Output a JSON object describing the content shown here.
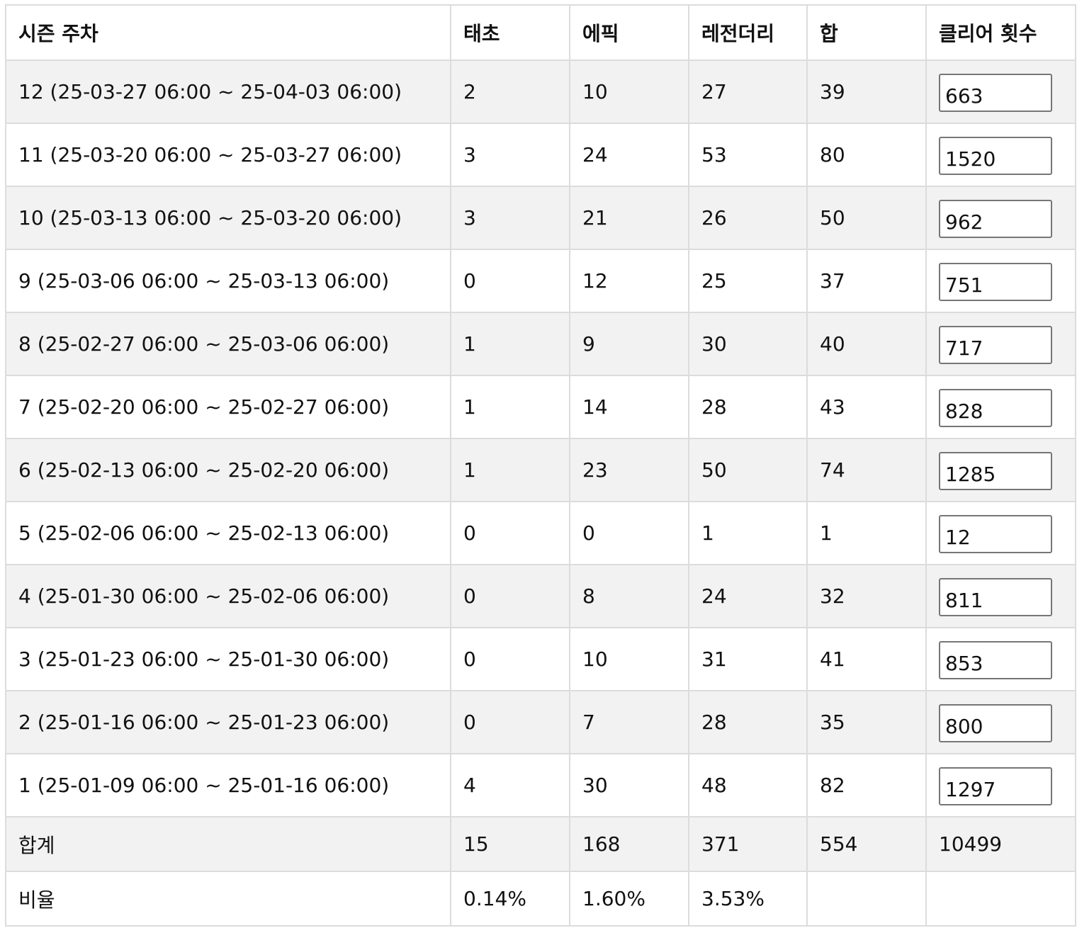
{
  "header": {
    "week": "시즌 주차",
    "taecho": "태초",
    "epic": "에픽",
    "legendary": "레전더리",
    "sum": "합",
    "clears": "클리어 횟수"
  },
  "rows": [
    {
      "week": "12 (25-03-27 06:00 ~ 25-04-03 06:00)",
      "taecho": "2",
      "epic": "10",
      "legendary": "27",
      "sum": "39",
      "clears": "663"
    },
    {
      "week": "11 (25-03-20 06:00 ~ 25-03-27 06:00)",
      "taecho": "3",
      "epic": "24",
      "legendary": "53",
      "sum": "80",
      "clears": "1520"
    },
    {
      "week": "10 (25-03-13 06:00 ~ 25-03-20 06:00)",
      "taecho": "3",
      "epic": "21",
      "legendary": "26",
      "sum": "50",
      "clears": "962"
    },
    {
      "week": "9 (25-03-06 06:00 ~ 25-03-13 06:00)",
      "taecho": "0",
      "epic": "12",
      "legendary": "25",
      "sum": "37",
      "clears": "751"
    },
    {
      "week": "8 (25-02-27 06:00 ~ 25-03-06 06:00)",
      "taecho": "1",
      "epic": "9",
      "legendary": "30",
      "sum": "40",
      "clears": "717"
    },
    {
      "week": "7 (25-02-20 06:00 ~ 25-02-27 06:00)",
      "taecho": "1",
      "epic": "14",
      "legendary": "28",
      "sum": "43",
      "clears": "828"
    },
    {
      "week": "6 (25-02-13 06:00 ~ 25-02-20 06:00)",
      "taecho": "1",
      "epic": "23",
      "legendary": "50",
      "sum": "74",
      "clears": "1285"
    },
    {
      "week": "5 (25-02-06 06:00 ~ 25-02-13 06:00)",
      "taecho": "0",
      "epic": "0",
      "legendary": "1",
      "sum": "1",
      "clears": "12"
    },
    {
      "week": "4 (25-01-30 06:00 ~ 25-02-06 06:00)",
      "taecho": "0",
      "epic": "8",
      "legendary": "24",
      "sum": "32",
      "clears": "811"
    },
    {
      "week": "3 (25-01-23 06:00 ~ 25-01-30 06:00)",
      "taecho": "0",
      "epic": "10",
      "legendary": "31",
      "sum": "41",
      "clears": "853"
    },
    {
      "week": "2 (25-01-16 06:00 ~ 25-01-23 06:00)",
      "taecho": "0",
      "epic": "7",
      "legendary": "28",
      "sum": "35",
      "clears": "800"
    },
    {
      "week": "1 (25-01-09 06:00 ~ 25-01-16 06:00)",
      "taecho": "4",
      "epic": "30",
      "legendary": "48",
      "sum": "82",
      "clears": "1297"
    }
  ],
  "total": {
    "label": "합계",
    "taecho": "15",
    "epic": "168",
    "legendary": "371",
    "sum": "554",
    "clears": "10499"
  },
  "ratio": {
    "label": "비율",
    "taecho": "0.14%",
    "epic": "1.60%",
    "legendary": "3.53%",
    "sum": "",
    "clears": ""
  }
}
